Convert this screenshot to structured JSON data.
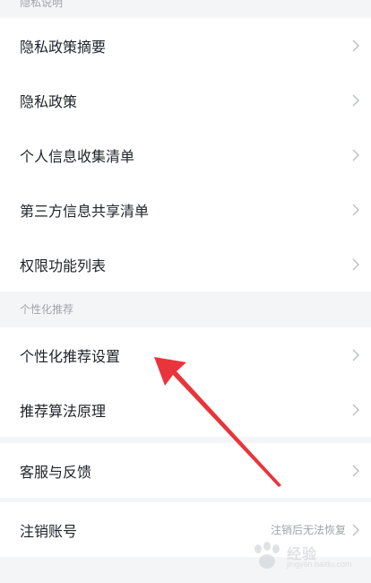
{
  "sections": {
    "privacy_header": "隐私说明",
    "personalized_header": "个性化推荐"
  },
  "privacy_items": [
    "隐私政策摘要",
    "隐私政策",
    "个人信息收集清单",
    "第三方信息共享清单",
    "权限功能列表"
  ],
  "personalized_items": [
    "个性化推荐设置",
    "推荐算法原理"
  ],
  "support_item": "客服与反馈",
  "account": {
    "label": "注销账号",
    "hint": "注销后无法恢复"
  },
  "watermark": {
    "text": "经验",
    "sub": "jingyan.baidu.com"
  },
  "colors": {
    "background": "#f4f5f7",
    "card": "#ffffff",
    "text": "#1f2329",
    "muted": "#a0a4aa",
    "arrow": "#e8353b"
  },
  "icons": {
    "chevron": "chevron-right-icon",
    "annotation": "red-arrow-icon"
  }
}
